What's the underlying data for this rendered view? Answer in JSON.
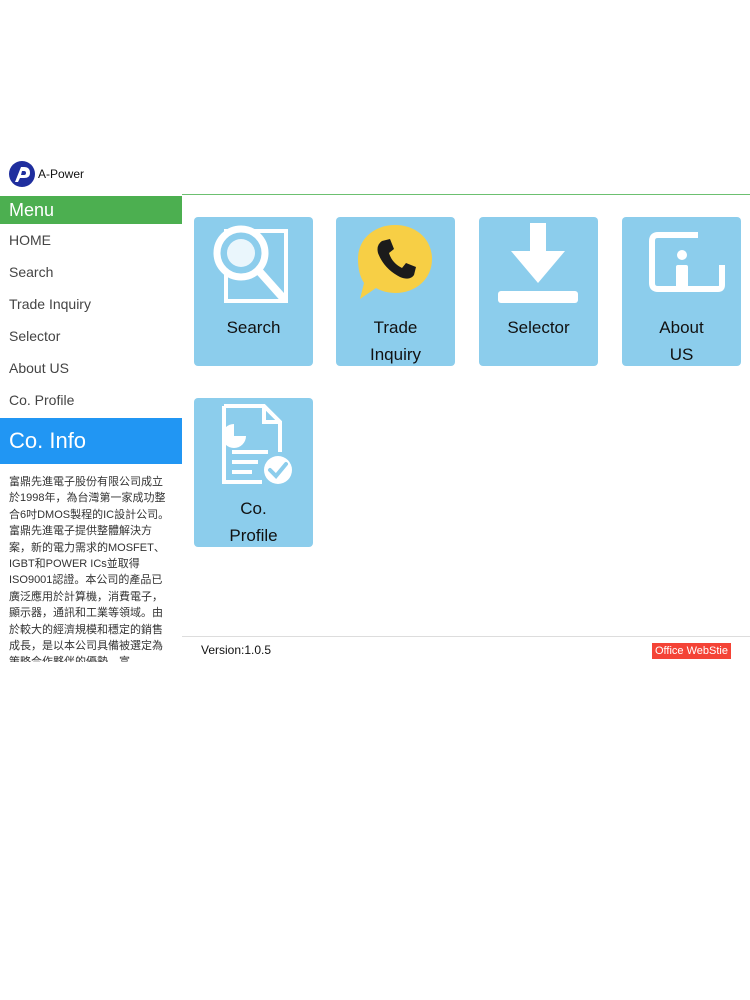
{
  "brand": {
    "name": "A-Power",
    "color": "#1f2e9e"
  },
  "menu": {
    "title": "Menu",
    "items": [
      "HOME",
      "Search",
      "Trade Inquiry",
      "Selector",
      "About US",
      "Co. Profile"
    ]
  },
  "co_info": {
    "title": "Co. Info",
    "text": "富鼎先進電子股份有限公司成立於1998年，為台灣第一家成功整合6吋DMOS製程的IC設計公司。富鼎先進電子提供整體解決方案，新的電力需求的MOSFET、IGBT和POWER ICs並取得ISO9001認證。本公司的產品已廣泛應用於計算機，消費電子，顯示器，通訊和工業等領域。由於較大的經濟規模和穩定的銷售成長，是以本公司具備被選定為策略合作夥伴的優勢。富"
  },
  "tiles": [
    {
      "label_line1": "Search",
      "label_line2": "",
      "icon": "magnifier-document-icon"
    },
    {
      "label_line1": "Trade",
      "label_line2": "Inquiry",
      "icon": "phone-chat-icon"
    },
    {
      "label_line1": "Selector",
      "label_line2": "",
      "icon": "download-icon"
    },
    {
      "label_line1": "About",
      "label_line2": "US",
      "icon": "info-icon"
    },
    {
      "label_line1": "Co.",
      "label_line2": "Profile",
      "icon": "report-check-icon"
    }
  ],
  "footer": {
    "version": "Version:1.0.5",
    "office_button": "Office WebStie"
  },
  "colors": {
    "menu_header": "#4caf50",
    "coinfo_header": "#2196f3",
    "tile_bg": "#8ccdec",
    "office_button": "#f44336"
  }
}
